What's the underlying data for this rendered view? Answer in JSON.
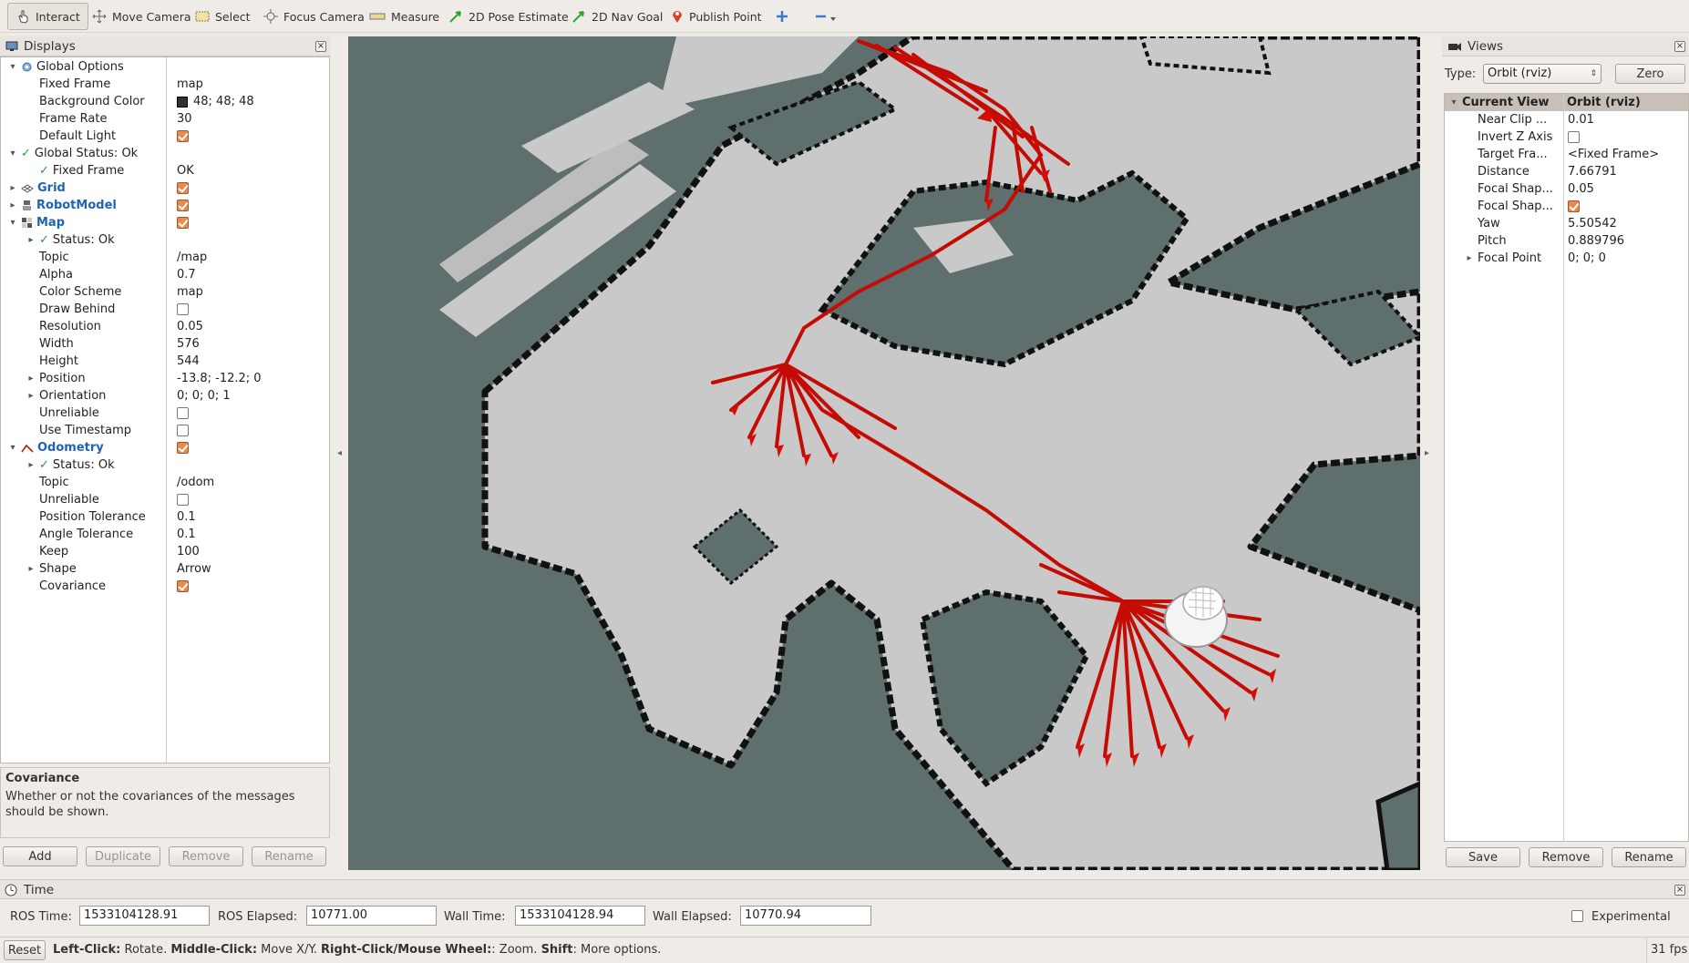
{
  "toolbar": {
    "interact": "Interact",
    "move_camera": "Move Camera",
    "select": "Select",
    "focus_camera": "Focus Camera",
    "measure": "Measure",
    "pose_estimate": "2D Pose Estimate",
    "nav_goal": "2D Nav Goal",
    "publish_point": "Publish Point"
  },
  "displays": {
    "title": "Displays",
    "rows": [
      {
        "label": "Global Options",
        "value": ""
      },
      {
        "label": "Fixed Frame",
        "value": "map"
      },
      {
        "label": "Background Color",
        "value": "48; 48; 48"
      },
      {
        "label": "Frame Rate",
        "value": "30"
      },
      {
        "label": "Default Light",
        "value": ""
      },
      {
        "label": "Global Status: Ok",
        "value": ""
      },
      {
        "label": "Fixed Frame",
        "value": "OK"
      },
      {
        "label": "Grid",
        "value": ""
      },
      {
        "label": "RobotModel",
        "value": ""
      },
      {
        "label": "Map",
        "value": ""
      },
      {
        "label": "Status: Ok",
        "value": ""
      },
      {
        "label": "Topic",
        "value": "/map"
      },
      {
        "label": "Alpha",
        "value": "0.7"
      },
      {
        "label": "Color Scheme",
        "value": "map"
      },
      {
        "label": "Draw Behind",
        "value": ""
      },
      {
        "label": "Resolution",
        "value": "0.05"
      },
      {
        "label": "Width",
        "value": "576"
      },
      {
        "label": "Height",
        "value": "544"
      },
      {
        "label": "Position",
        "value": "-13.8; -12.2; 0"
      },
      {
        "label": "Orientation",
        "value": "0; 0; 0; 1"
      },
      {
        "label": "Unreliable",
        "value": ""
      },
      {
        "label": "Use Timestamp",
        "value": ""
      },
      {
        "label": "Odometry",
        "value": ""
      },
      {
        "label": "Status: Ok",
        "value": ""
      },
      {
        "label": "Topic",
        "value": "/odom"
      },
      {
        "label": "Unreliable",
        "value": ""
      },
      {
        "label": "Position Tolerance",
        "value": "0.1"
      },
      {
        "label": "Angle Tolerance",
        "value": "0.1"
      },
      {
        "label": "Keep",
        "value": "100"
      },
      {
        "label": "Shape",
        "value": "Arrow"
      },
      {
        "label": "Covariance",
        "value": ""
      }
    ],
    "desc_title": "Covariance",
    "desc_text": "Whether or not the covariances of the messages should be shown.",
    "add": "Add",
    "duplicate": "Duplicate",
    "remove": "Remove",
    "rename": "Rename"
  },
  "views": {
    "title": "Views",
    "type_label": "Type:",
    "type_value": "Orbit (rviz)",
    "zero": "Zero",
    "header_key": "Current View",
    "header_value": "Orbit (rviz)",
    "rows": [
      {
        "label": "Near Clip ...",
        "value": "0.01"
      },
      {
        "label": "Invert Z Axis",
        "value": ""
      },
      {
        "label": "Target Fra...",
        "value": "<Fixed Frame>"
      },
      {
        "label": "Distance",
        "value": "7.66791"
      },
      {
        "label": "Focal Shap...",
        "value": "0.05"
      },
      {
        "label": "Focal Shap...",
        "value": ""
      },
      {
        "label": "Yaw",
        "value": "5.50542"
      },
      {
        "label": "Pitch",
        "value": "0.889796"
      },
      {
        "label": "Focal Point",
        "value": "0; 0; 0"
      }
    ],
    "save": "Save",
    "remove": "Remove",
    "rename": "Rename"
  },
  "time": {
    "title": "Time",
    "ros_time_label": "ROS Time:",
    "ros_time": "1533104128.91",
    "ros_elapsed_label": "ROS Elapsed:",
    "ros_elapsed": "10771.00",
    "wall_time_label": "Wall Time:",
    "wall_time": "1533104128.94",
    "wall_elapsed_label": "Wall Elapsed:",
    "wall_elapsed": "10770.94",
    "experimental": "Experimental"
  },
  "status": {
    "reset": "Reset",
    "left_click": "Left-Click:",
    "rotate": " Rotate. ",
    "middle_click": "Middle-Click:",
    "move_xy": " Move X/Y. ",
    "right_click": "Right-Click/Mouse Wheel:",
    "zoom": ": Zoom. ",
    "shift": "Shift",
    "more": ": More options.",
    "fps": "31 fps"
  },
  "colors": {
    "map_unknown": "#5f6f6e",
    "map_free": "#c9c9c9",
    "map_wall": "#111111",
    "odom_arrow": "#d40e06",
    "accent_blue": "#1f64b3"
  }
}
